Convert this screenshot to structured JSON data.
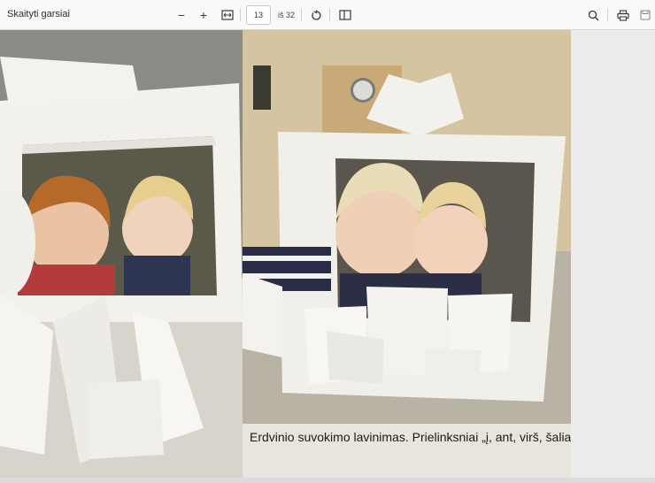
{
  "toolbar": {
    "read_aloud_label": "Skaityti garsiai",
    "zoom_out": "−",
    "zoom_in": "+",
    "page_number": "13",
    "page_total": "iš 32"
  },
  "page": {
    "caption": "Erdvinio suvokimo lavinimas. Prielinksniai „į, ant, virš, šalia“."
  },
  "colors": {
    "toolbar_bg": "#f9f9fb",
    "page_bg": "#ffffff",
    "viewer_bg": "#ececec"
  }
}
